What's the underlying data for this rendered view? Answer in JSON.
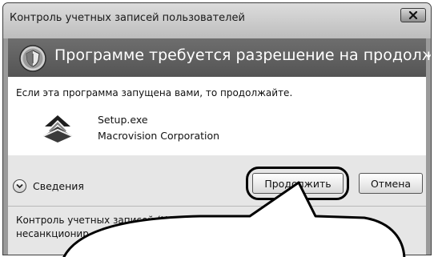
{
  "window": {
    "title": "Контроль учетных записей пользователей",
    "close_symbol": "x"
  },
  "banner": {
    "heading": "Программе требуется разрешение на продолжение",
    "icon": "uac-shield-icon"
  },
  "content": {
    "prompt": "Если эта программа запущена вами, то продолжайте.",
    "program": {
      "name": "Setup.exe",
      "vendor": "Macrovision Corporation",
      "icon": "setup-program-icon"
    }
  },
  "footer": {
    "details_label": "Сведения",
    "details_icon": "chevron-down-icon",
    "continue_label": "Продолжить",
    "cancel_label": "Отмена",
    "info_line1": "Контроль учетных записей (UAC) помогает пред   атить",
    "info_line2": "несанкционир"
  },
  "colors": {
    "banner": "#5f5f5f",
    "frame": "#9a9a9a",
    "footer": "#e6e6e6"
  }
}
